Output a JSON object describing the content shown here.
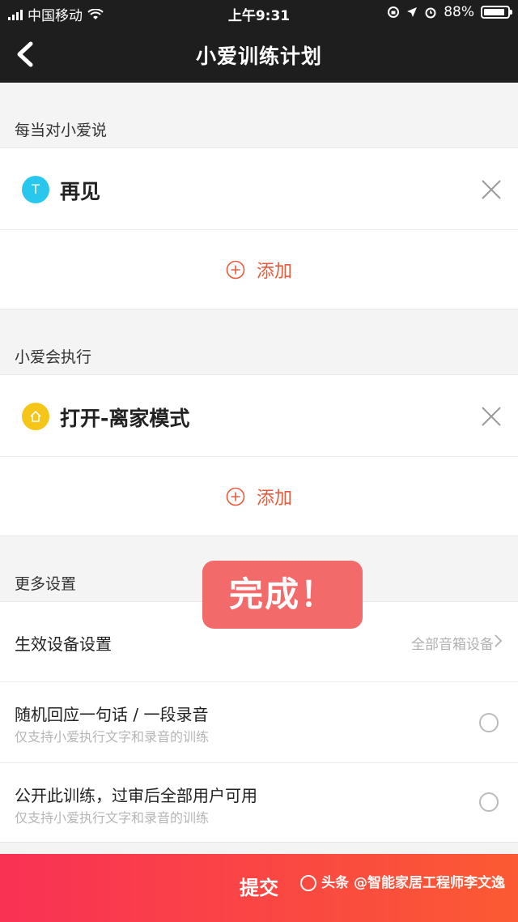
{
  "status_bar": {
    "carrier": "中国移动",
    "time": "上午9:31",
    "battery": "88%",
    "battery_level": 0.88
  },
  "nav": {
    "title": "小爱训练计划",
    "back_icon": "chevron-left-icon"
  },
  "trigger_section": {
    "title": "每当对小爱说",
    "items": [
      {
        "badge": "T",
        "label": "再见"
      }
    ],
    "add_label": "添加"
  },
  "action_section": {
    "title": "小爱会执行",
    "items": [
      {
        "badge": "home-icon",
        "label": "打开-离家模式"
      }
    ],
    "add_label": "添加"
  },
  "more_settings": {
    "title": "更多设置",
    "device": {
      "label": "生效设备设置",
      "value": "全部音箱设备"
    },
    "random_reply": {
      "label": "随机回应一句话 / 一段录音",
      "sub": "仅支持小爱执行文字和录音的训练",
      "checked": false
    },
    "public": {
      "label": "公开此训练，过审后全部用户可用",
      "sub": "仅支持小爱执行文字和录音的训练",
      "checked": false
    }
  },
  "toast": {
    "text": "完成！"
  },
  "submit": {
    "label": "提交"
  },
  "watermark": {
    "text": "头条 @智能家居工程师李文逸"
  },
  "colors": {
    "accent": "#e85a3c",
    "toast": "#f36a6a",
    "submit_start": "#f93155",
    "submit_end": "#fb5a33",
    "badge_t": "#29c6ee",
    "badge_home": "#f5c518"
  }
}
